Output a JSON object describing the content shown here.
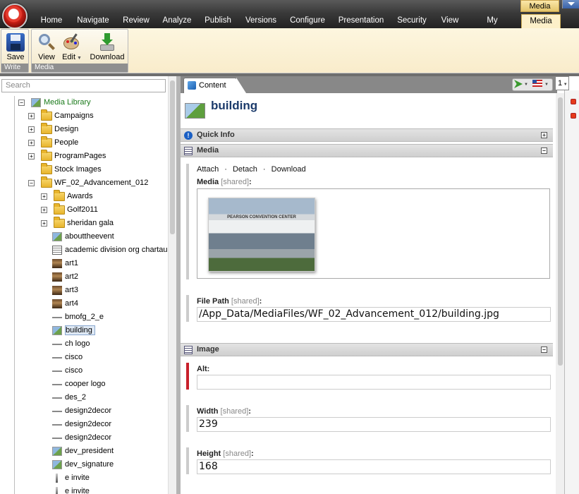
{
  "ribbon": {
    "tabs": [
      "Home",
      "Navigate",
      "Review",
      "Analyze",
      "Publish",
      "Versions",
      "Configure",
      "Presentation",
      "Security",
      "View",
      "My Toolbar",
      "Media"
    ],
    "selected_tab": "Media",
    "context_label": "Media",
    "groups": {
      "write": {
        "label": "Write",
        "buttons": {
          "save": "Save"
        }
      },
      "media": {
        "label": "Media",
        "buttons": {
          "view": "View",
          "edit": "Edit",
          "download": "Download"
        }
      }
    }
  },
  "tree": {
    "search_placeholder": "Search",
    "root": "Media Library",
    "folders": [
      "Campaigns",
      "Design",
      "People",
      "ProgramPages",
      "Stock Images",
      "WF_02_Advancement_012"
    ],
    "subfolders": [
      "Awards",
      "Golf2011",
      "sheridan gala"
    ],
    "items": [
      "abouttheevent",
      "academic division org chartaug",
      "art1",
      "art2",
      "art3",
      "art4",
      "bmofg_2_e",
      "building",
      "ch logo",
      "cisco",
      "cisco",
      "cooper logo",
      "des_2",
      "design2decor",
      "design2decor",
      "design2decor",
      "dev_president",
      "dev_signature",
      "e invite",
      "e invite"
    ],
    "selected_item": "building"
  },
  "content": {
    "tab_label": "Content",
    "version_number": "1",
    "item_title": "building",
    "sections": {
      "quick_info": "Quick Info",
      "media": "Media",
      "image": "Image"
    },
    "media_actions": [
      "Attach",
      "Detach",
      "Download"
    ],
    "media_separator": "·",
    "fields": {
      "media_label": "Media",
      "shared_tag": "[shared]",
      "photo_caption": "PEARSON CONVENTION CENTER",
      "file_path_label": "File Path",
      "file_path_value": "/App_Data/MediaFiles/WF_02_Advancement_012/building.jpg",
      "alt_label": "Alt:",
      "alt_value": "",
      "width_label": "Width",
      "width_value": "239",
      "height_label": "Height",
      "height_value": "168"
    }
  },
  "colors": {
    "accent_required": "#c8202b",
    "title_color": "#1c3b6b",
    "tree_root_color": "#1a7a1a"
  }
}
